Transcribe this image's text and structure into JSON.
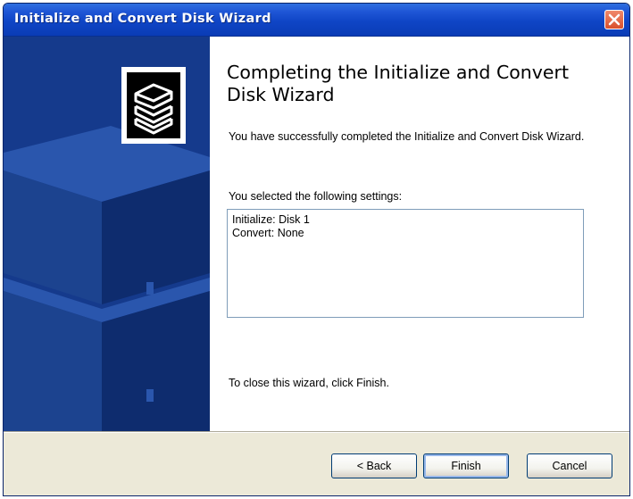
{
  "window": {
    "title": "Initialize and Convert Disk Wizard"
  },
  "wizard": {
    "heading": "Completing the Initialize and Convert Disk Wizard",
    "success_message": "You have successfully completed the Initialize and Convert Disk Wizard.",
    "settings_label": "You selected the following settings:",
    "settings": [
      "Initialize: Disk 1",
      "Convert: None"
    ],
    "close_instruction": "To close this wizard, click Finish."
  },
  "buttons": {
    "back": "< Back",
    "finish": "Finish",
    "cancel": "Cancel"
  },
  "icons": {
    "close": "close-icon",
    "wizard_art": "disk-stack-icon"
  },
  "colors": {
    "titlebar": "#0a3cb6",
    "left_panel": "#153a8c",
    "close_button": "#d9502c",
    "dialog_bg": "#ece9d8"
  }
}
